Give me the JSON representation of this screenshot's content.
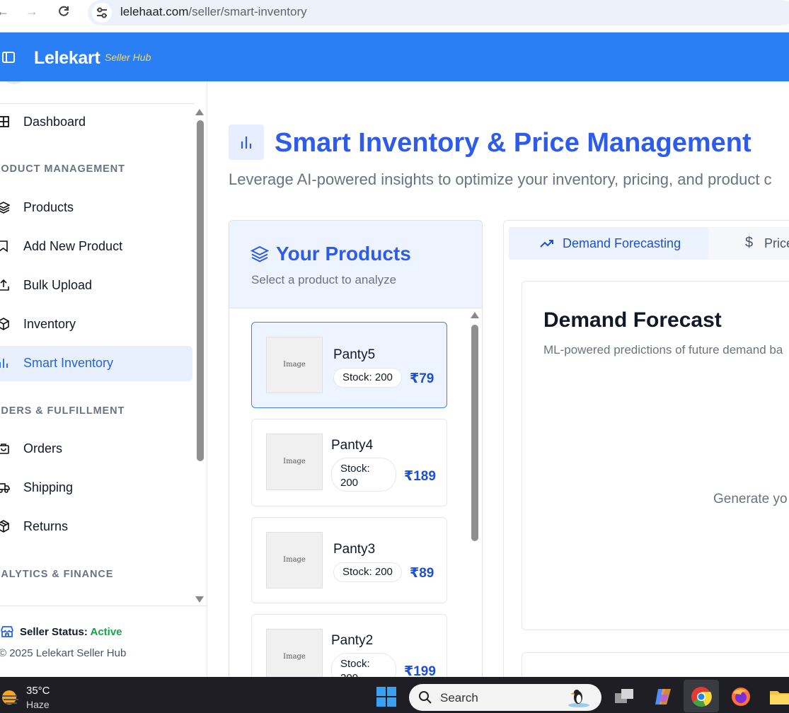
{
  "browser": {
    "url_domain": "lelehaat.com",
    "url_path": "/seller/smart-inventory"
  },
  "header": {
    "brand": "Lelekart",
    "brand_sub": "Seller Hub"
  },
  "sidebar": {
    "items": [
      {
        "label": "Dashboard",
        "icon": "grid-icon"
      },
      {
        "label": "Products",
        "icon": "layers-icon"
      },
      {
        "label": "Add New Product",
        "icon": "bookmark-icon"
      },
      {
        "label": "Bulk Upload",
        "icon": "upload-icon"
      },
      {
        "label": "Inventory",
        "icon": "box-icon"
      },
      {
        "label": "Smart Inventory",
        "icon": "bar-chart-icon",
        "active": true
      },
      {
        "label": "Orders",
        "icon": "bag-icon"
      },
      {
        "label": "Shipping",
        "icon": "truck-icon"
      },
      {
        "label": "Returns",
        "icon": "package-icon"
      }
    ],
    "sections": {
      "product": "RODUCT MANAGEMENT",
      "orders": "RDERS & FULFILLMENT",
      "analytics": "NALYTICS & FINANCE"
    },
    "footer": {
      "status_label": "Seller Status:",
      "status_value": "Active",
      "copyright": "© 2025 Lelekart Seller Hub"
    }
  },
  "main": {
    "title": "Smart Inventory & Price Management",
    "subtitle": "Leverage AI-powered insights to optimize your inventory, pricing, and product c",
    "products": {
      "title": "Your Products",
      "subtitle": "Select a product to analyze",
      "image_placeholder": "Image",
      "items": [
        {
          "name": "Panty5",
          "stock": "Stock: 200",
          "price": "₹79"
        },
        {
          "name": "Panty4",
          "stock": "Stock: 200",
          "price": "₹189"
        },
        {
          "name": "Panty3",
          "stock": "Stock: 200",
          "price": "₹89"
        },
        {
          "name": "Panty2",
          "stock": "Stock: 200",
          "price": "₹199"
        }
      ]
    },
    "tabs": {
      "demand": "Demand Forecasting",
      "price": "Price"
    },
    "forecast": {
      "title": "Demand Forecast",
      "subtitle": "ML-powered predictions of future demand ba",
      "empty": "Generate yo"
    }
  },
  "taskbar": {
    "temp": "35°C",
    "weather": "Haze",
    "search": "Search"
  },
  "colors": {
    "brand_blue": "#2b7ff5",
    "accent_blue": "#2e5bea",
    "active_green": "#16a34a"
  }
}
